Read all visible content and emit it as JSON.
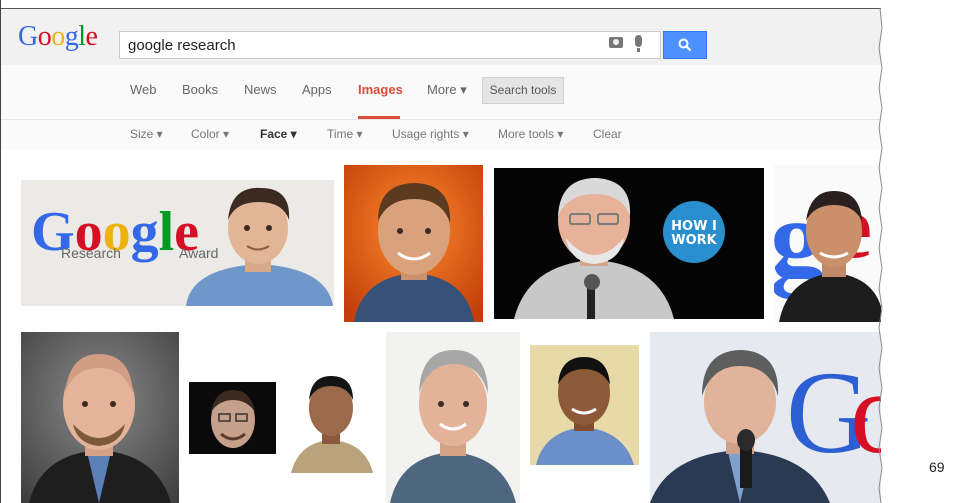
{
  "search": {
    "query": "google research"
  },
  "logo": "Google",
  "nav": {
    "items": [
      "Web",
      "Books",
      "News",
      "Apps",
      "Images",
      "More ▾"
    ],
    "active": "Images",
    "search_tools": "Search tools"
  },
  "filters": [
    "Size ▾",
    "Color ▾",
    "Face ▾",
    "Time ▾",
    "Usage rights ▾",
    "More tools ▾",
    "Clear"
  ],
  "results": {
    "r1": {
      "logo_text": "Google",
      "sub_left": "Research",
      "sub_right": "Award"
    },
    "r3": {
      "badge": "HOW I\nWORK"
    }
  },
  "page_number": "69",
  "colors": {
    "g_blue": "#3369e8",
    "g_red": "#d50f25",
    "g_yellow": "#eeb211",
    "g_green": "#009925",
    "accent": "#dd4b39",
    "search_blue": "#4d90fe"
  }
}
